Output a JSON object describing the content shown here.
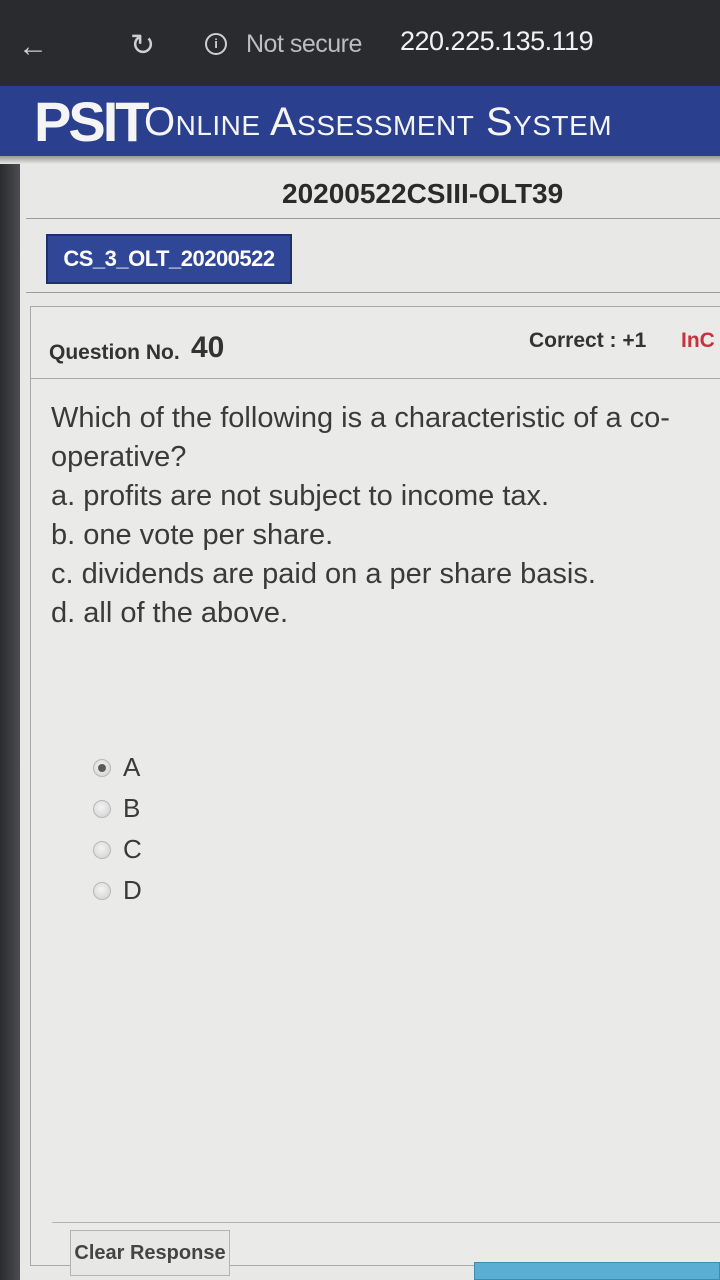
{
  "browser": {
    "back_icon": "arrow-left-icon",
    "reload_icon": "reload-icon",
    "info_icon": "info-circle-icon",
    "info_glyph": "i",
    "security_label": "Not secure",
    "url": "220.225.135.119"
  },
  "header": {
    "brand": "PSIT",
    "system_name": "Online Assessment System",
    "brand_color": "#2b3f8f"
  },
  "exam": {
    "title": "20200522CSIII-OLT39",
    "section_tab": "CS_3_OLT_20200522"
  },
  "question": {
    "number_label": "Question No.",
    "number": "40",
    "correct_marks": "Correct : +1",
    "incorrect_marks": "InC",
    "text": "Which of the following is a characteristic of a co-operative?",
    "options": [
      "a. profits are not subject to income tax.",
      "b. one vote per share.",
      "c. dividends are paid on a per share basis.",
      "d. all of the above."
    ]
  },
  "choices": [
    {
      "label": "A",
      "selected": true
    },
    {
      "label": "B",
      "selected": false
    },
    {
      "label": "C",
      "selected": false
    },
    {
      "label": "D",
      "selected": false
    }
  ],
  "footer": {
    "clear_response": "Clear Response"
  }
}
